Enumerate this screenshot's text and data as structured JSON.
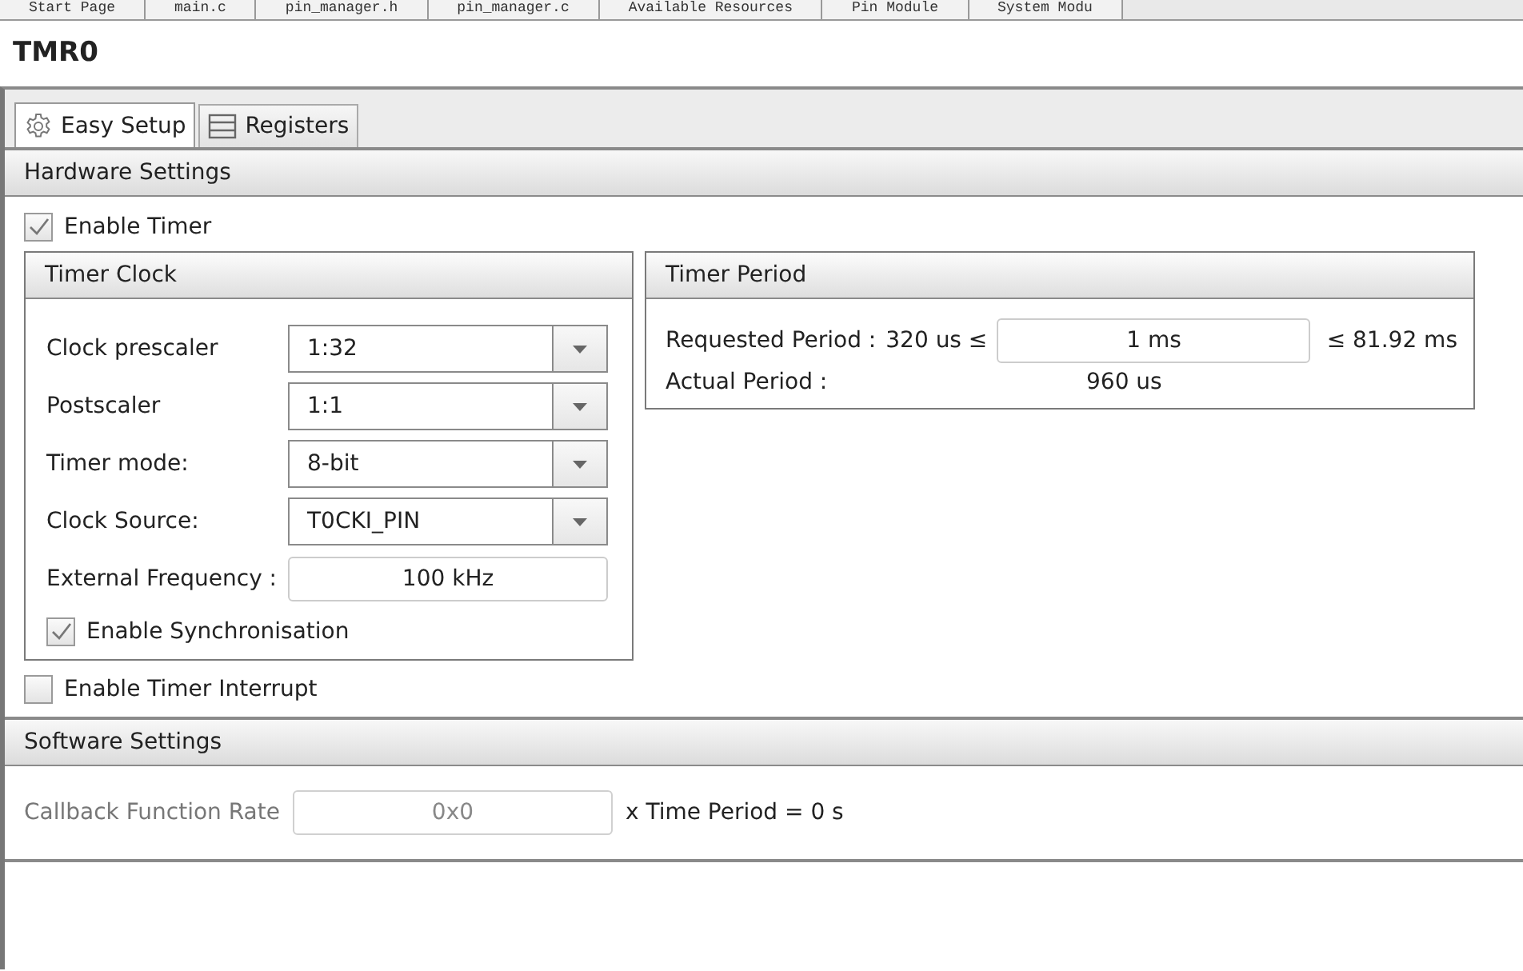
{
  "editor_tabs": [
    {
      "label": "Start Page",
      "selected": false
    },
    {
      "label": "main.c",
      "selected": false
    },
    {
      "label": "pin_manager.h",
      "selected": false
    },
    {
      "label": "pin_manager.c",
      "selected": false
    },
    {
      "label": "Available Resources",
      "selected": false
    },
    {
      "label": "Pin Module",
      "selected": false
    },
    {
      "label": "System Modu",
      "selected": false
    }
  ],
  "title": "TMR0",
  "tabs": [
    {
      "label": "Easy Setup",
      "kind": "gear",
      "selected": true
    },
    {
      "label": "Registers",
      "kind": "list",
      "selected": false
    }
  ],
  "hardware_settings": {
    "title": "Hardware Settings",
    "enable_timer": {
      "label": "Enable Timer",
      "checked": true
    },
    "timer_clock": {
      "title": "Timer Clock",
      "combos": [
        {
          "label": "Clock prescaler",
          "value": "1:32"
        },
        {
          "label": "Postscaler",
          "value": "1:1"
        },
        {
          "label": "Timer mode:",
          "value": "8-bit"
        },
        {
          "label": "Clock Source:",
          "value": "T0CKI_PIN"
        }
      ],
      "external_frequency": {
        "label": "External Frequency :",
        "value": "100 kHz"
      },
      "enable_synchronisation": {
        "label": "Enable Synchronisation",
        "checked": true
      }
    },
    "timer_period": {
      "title": "Timer Period",
      "requested_label": "Requested Period :",
      "min": "320 us  ≤",
      "requested_value": "1 ms",
      "max": "≤  81.92 ms",
      "actual_label": "Actual Period :",
      "actual_value": "960 us"
    },
    "enable_interrupt": {
      "label": "Enable Timer Interrupt",
      "checked": false
    }
  },
  "software_settings": {
    "title": "Software Settings",
    "callback_label": "Callback Function Rate",
    "callback_value": "0x0",
    "disabled": true,
    "result": "x Time Period =  0 s"
  }
}
